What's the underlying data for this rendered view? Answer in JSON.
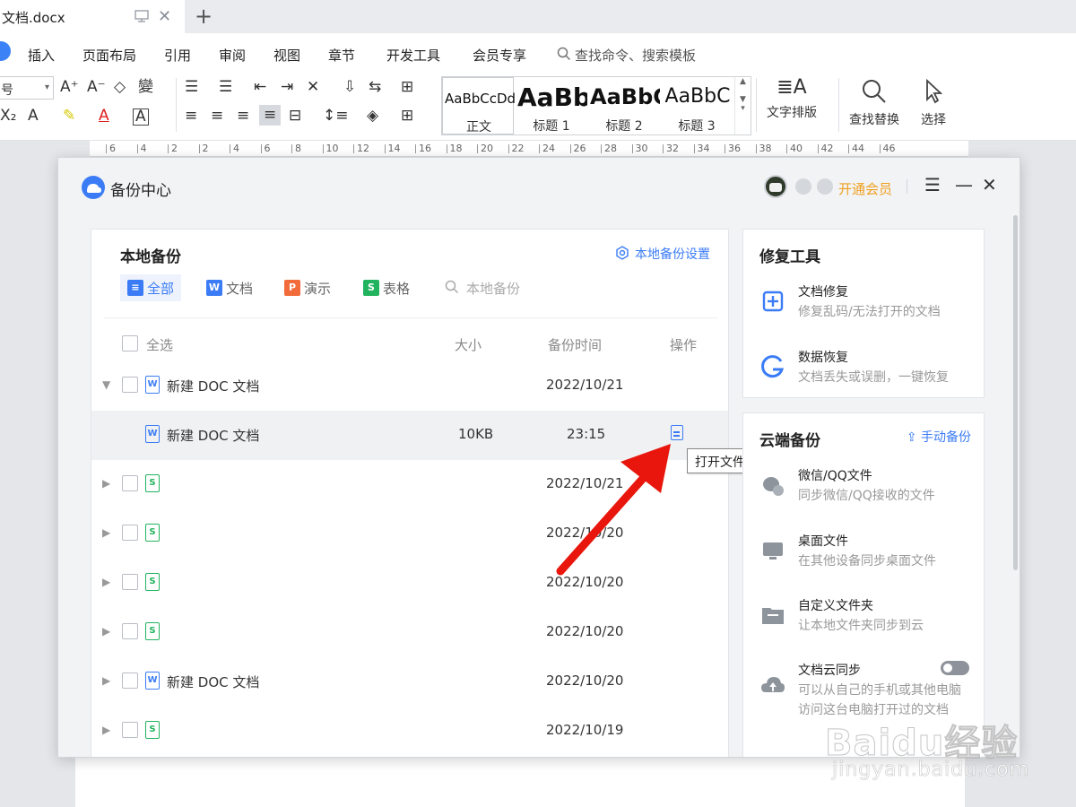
{
  "tab": {
    "title": "文档.docx"
  },
  "menu": {
    "items": [
      "插入",
      "页面布局",
      "引用",
      "审阅",
      "视图",
      "章节",
      "开发工具",
      "会员专享"
    ],
    "search_placeholder": "查找命令、搜索模板"
  },
  "ribbon": {
    "font_size_value": "号",
    "styles": [
      {
        "preview": "AaBbCcDd",
        "label": "正文"
      },
      {
        "preview": "AaBb",
        "label": "标题 1"
      },
      {
        "preview": "AaBbC",
        "label": "标题 2"
      },
      {
        "preview": "AaBbC",
        "label": "标题 3"
      }
    ],
    "text_layout": "文字排版",
    "find_replace": "查找替换",
    "select": "选择"
  },
  "ruler": {
    "labels": [
      "6",
      "4",
      "2",
      "2",
      "4",
      "6",
      "8",
      "10",
      "12",
      "14",
      "16",
      "18",
      "20",
      "22",
      "24",
      "26",
      "28",
      "30",
      "32",
      "34",
      "36",
      "38",
      "40",
      "42",
      "44",
      "46"
    ]
  },
  "dialog": {
    "title": "备份中心",
    "vip_label": "开通会员",
    "local": {
      "title": "本地备份",
      "settings_link": "本地备份设置",
      "filters": [
        {
          "label": "全部",
          "icon": "all-icon",
          "color": "#3b7cf6",
          "glyph": "≡"
        },
        {
          "label": "文档",
          "icon": "writer-icon",
          "color": "#3b7cf6",
          "glyph": "W"
        },
        {
          "label": "演示",
          "icon": "presentation-icon",
          "color": "#f26b3a",
          "glyph": "P"
        },
        {
          "label": "表格",
          "icon": "spreadsheet-icon",
          "color": "#22b35e",
          "glyph": "S"
        }
      ],
      "search_placeholder": "本地备份",
      "columns": {
        "select_all": "全选",
        "size": "大小",
        "time": "备份时间",
        "action": "操作"
      },
      "rows": [
        {
          "type": "w",
          "name": "新建 DOC 文档",
          "size": "",
          "date": "2022/10/21",
          "expanded": true,
          "child": false
        },
        {
          "type": "w",
          "name": "新建 DOC 文档",
          "size": "10KB",
          "date": "23:15",
          "expanded": false,
          "child": true
        },
        {
          "type": "s",
          "name": "",
          "size": "",
          "date": "2022/10/21",
          "expanded": false,
          "child": false
        },
        {
          "type": "s",
          "name": "",
          "size": "",
          "date": "2022/10/20",
          "expanded": false,
          "child": false
        },
        {
          "type": "s",
          "name": "",
          "size": "",
          "date": "2022/10/20",
          "expanded": false,
          "child": false
        },
        {
          "type": "s",
          "name": "",
          "size": "",
          "date": "2022/10/20",
          "expanded": false,
          "child": false
        },
        {
          "type": "w",
          "name": "新建 DOC 文档",
          "size": "",
          "date": "2022/10/20",
          "expanded": false,
          "child": false
        },
        {
          "type": "s",
          "name": "",
          "size": "",
          "date": "2022/10/19",
          "expanded": false,
          "child": false
        }
      ],
      "tooltip": "打开文件"
    },
    "repair": {
      "title": "修复工具",
      "items": [
        {
          "title": "文档修复",
          "desc": "修复乱码/无法打开的文档",
          "icon": "document-repair-icon"
        },
        {
          "title": "数据恢复",
          "desc": "文档丢失或误删，一键恢复",
          "icon": "data-recovery-icon"
        }
      ]
    },
    "cloud": {
      "title": "云端备份",
      "manual_backup": "手动备份",
      "items": [
        {
          "title": "微信/QQ文件",
          "desc": "同步微信/QQ接收的文件",
          "icon": "chat-files-icon"
        },
        {
          "title": "桌面文件",
          "desc": "在其他设备同步桌面文件",
          "icon": "desktop-icon"
        },
        {
          "title": "自定义文件夹",
          "desc": "让本地文件夹同步到云",
          "icon": "folder-icon"
        },
        {
          "title": "文档云同步",
          "desc": "可以从自己的手机或其他电脑",
          "desc2": "访问这台电脑打开过的文档",
          "icon": "cloud-upload-icon",
          "toggle": false
        }
      ]
    }
  },
  "watermark": {
    "brand": "Bai",
    "brand2": "du",
    "brand3": "经验",
    "url": "jingyan.baidu.com"
  },
  "colors": {
    "accent": "#3b7cf6",
    "vip": "#f0a01f",
    "arrow": "#e8160c"
  }
}
